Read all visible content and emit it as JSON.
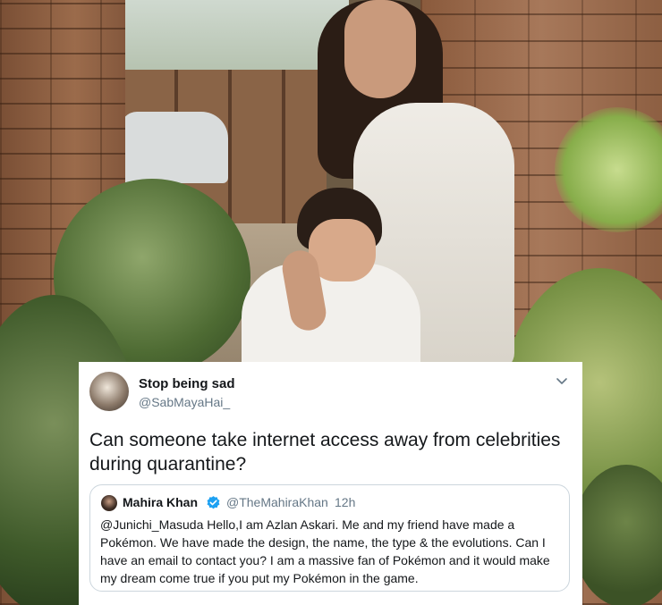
{
  "tweet": {
    "display_name": "Stop being sad",
    "handle": "@SabMayaHai_",
    "text": "Can someone take internet access away from celebrities during quarantine?",
    "menu_icon": "chevron-down-icon"
  },
  "quoted_tweet": {
    "display_name": "Mahira Khan",
    "verified_icon": "verified-badge-icon",
    "handle": "@TheMahiraKhan",
    "separator": "·",
    "time": "12h",
    "text": "@Junichi_Masuda   Hello,I am Azlan Askari. Me and my friend have made a Pokémon. We have made the design, the name, the type & the evolutions. Can I have an email to contact you? I am a massive fan of Pokémon and it would make my dream come true if you put my Pokémon in the game."
  },
  "colors": {
    "primary_text": "#14171a",
    "secondary_text": "#657786",
    "border": "#ccd6dd",
    "verified": "#1da1f2"
  }
}
